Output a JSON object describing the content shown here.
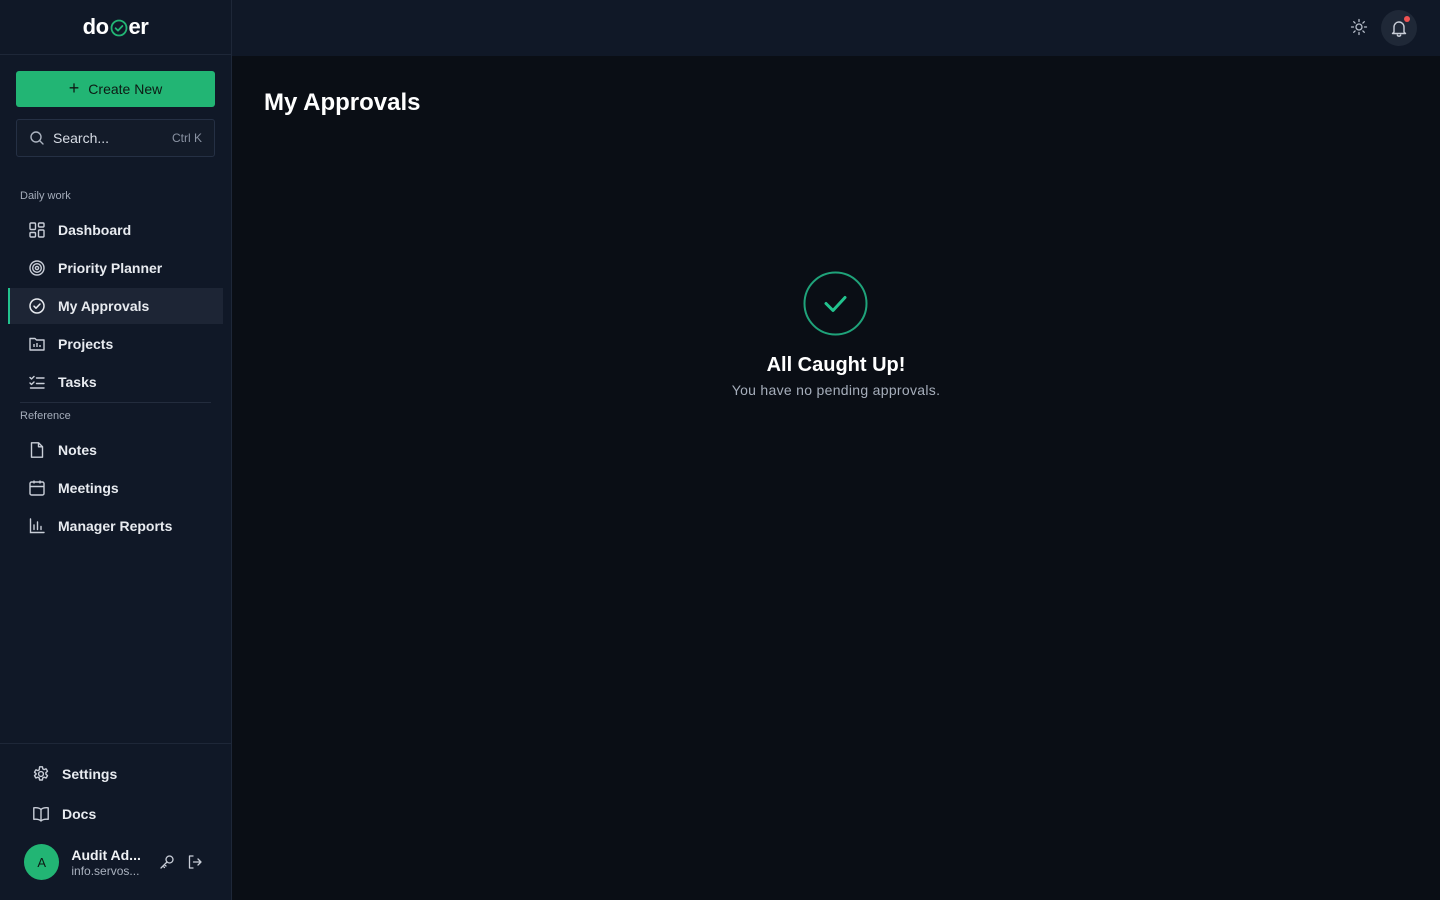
{
  "app": {
    "logo_left": "do",
    "logo_right": "er",
    "brand_color": "#22b574"
  },
  "sidebar": {
    "create_button_label": "Create New",
    "search": {
      "placeholder": "Search...",
      "shortcut": "Ctrl K"
    },
    "sections": [
      {
        "label": "Daily work",
        "items": [
          {
            "label": "Dashboard",
            "icon": "grid-icon"
          },
          {
            "label": "Priority Planner",
            "icon": "target-icon"
          },
          {
            "label": "My Approvals",
            "icon": "check-circle-icon",
            "active": true
          },
          {
            "label": "Projects",
            "icon": "chart-folder-icon"
          },
          {
            "label": "Tasks",
            "icon": "checklist-icon"
          }
        ]
      },
      {
        "label": "Reference",
        "items": [
          {
            "label": "Notes",
            "icon": "file-icon"
          },
          {
            "label": "Meetings",
            "icon": "calendar-icon"
          },
          {
            "label": "Manager Reports",
            "icon": "bar-chart-icon"
          }
        ]
      }
    ],
    "bottom": {
      "settings_label": "Settings",
      "docs_label": "Docs"
    },
    "user": {
      "initial": "A",
      "name": "Audit Ad...",
      "email": "info.servos..."
    }
  },
  "main": {
    "title": "My Approvals",
    "empty_state": {
      "title": "All Caught Up!",
      "message": "You have no pending approvals."
    }
  }
}
